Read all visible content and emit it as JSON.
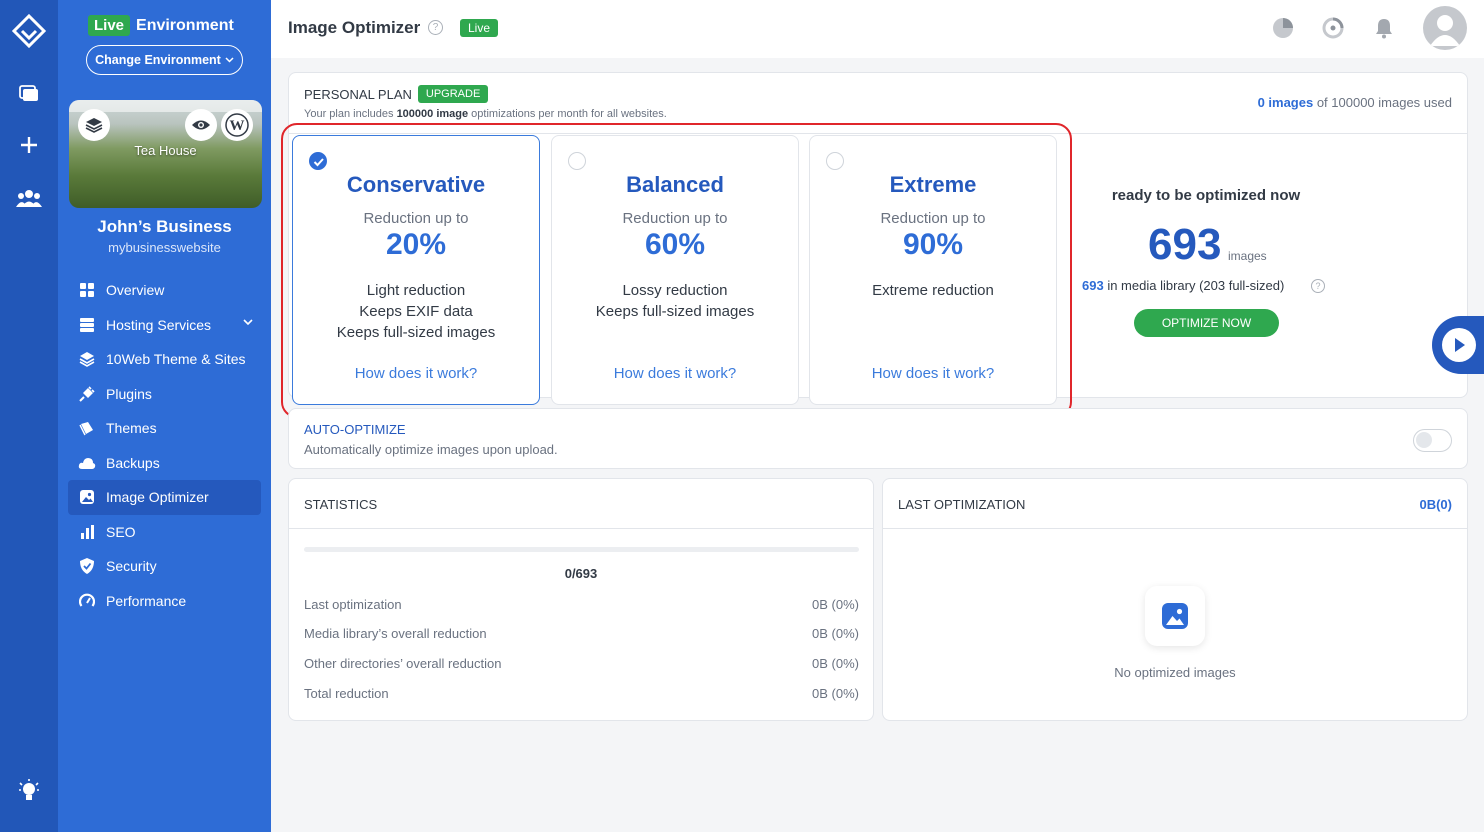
{
  "sidebar": {
    "env_badge": "Live",
    "env_label": "Environment",
    "change_env": "Change Environment",
    "site_thumb_title": "Tea House",
    "business_name": "John’s Business",
    "business_url": "mybusinesswebsite",
    "items": [
      {
        "label": "Overview",
        "icon": "grid-icon"
      },
      {
        "label": "Hosting Services",
        "icon": "server-icon"
      },
      {
        "label": "10Web Theme & Sites",
        "icon": "layers-icon"
      },
      {
        "label": "Plugins",
        "icon": "plug-icon"
      },
      {
        "label": "Themes",
        "icon": "brush-icon"
      },
      {
        "label": "Backups",
        "icon": "cloud-icon"
      },
      {
        "label": "Image Optimizer",
        "icon": "image-icon",
        "active": true
      },
      {
        "label": "SEO",
        "icon": "bar-chart-icon"
      },
      {
        "label": "Security",
        "icon": "shield-icon"
      },
      {
        "label": "Performance",
        "icon": "gauge-icon"
      }
    ]
  },
  "header": {
    "title": "Image Optimizer",
    "help": "?",
    "live_badge": "Live"
  },
  "plan": {
    "label": "PERSONAL PLAN",
    "upgrade": "UPGRADE",
    "sub_pre": "Your plan includes ",
    "sub_bold": "100000 image",
    "sub_post": " optimizations per month for all websites.",
    "used_count": "0 images",
    "used_rest": " of 100000 images used"
  },
  "modes": [
    {
      "name": "Conservative",
      "reduction_label": "Reduction up to",
      "percent": "20%",
      "desc": [
        "Light reduction",
        "Keeps EXIF data",
        "Keeps full-sized images"
      ],
      "link": "How does it work?",
      "selected": true
    },
    {
      "name": "Balanced",
      "reduction_label": "Reduction up to",
      "percent": "60%",
      "desc": [
        "Lossy reduction",
        "Keeps full-sized images"
      ],
      "link": "How does it work?",
      "selected": false
    },
    {
      "name": "Extreme",
      "reduction_label": "Reduction up to",
      "percent": "90%",
      "desc": [
        "Extreme reduction"
      ],
      "link": "How does it work?",
      "selected": false
    }
  ],
  "ready": {
    "heading": "ready to be optimized now",
    "count": "693",
    "unit": "images",
    "lib_count": "693",
    "lib_rest": " in media library (203 full-sized)",
    "help": "?",
    "button": "OPTIMIZE NOW"
  },
  "auto": {
    "title": "AUTO-OPTIMIZE",
    "sub": "Automatically optimize images upon upload.",
    "enabled": false
  },
  "stats": {
    "title": "STATISTICS",
    "progress_text": "0/693",
    "progress_fraction": 0,
    "rows": [
      {
        "label": "Last optimization",
        "value": "0B (0%)"
      },
      {
        "label": "Media library’s overall reduction",
        "value": "0B (0%)"
      },
      {
        "label": "Other directories’ overall reduction",
        "value": "0B (0%)"
      },
      {
        "label": "Total reduction",
        "value": "0B (0%)"
      }
    ]
  },
  "last": {
    "title": "LAST OPTIMIZATION",
    "value": "0B(0)",
    "empty": "No optimized images"
  },
  "colors": {
    "rail": "#2257b8",
    "sidebar": "#2e6cd6",
    "accent": "#2e6cd6",
    "green": "#2fa84f",
    "highlight": "#e0262b"
  }
}
